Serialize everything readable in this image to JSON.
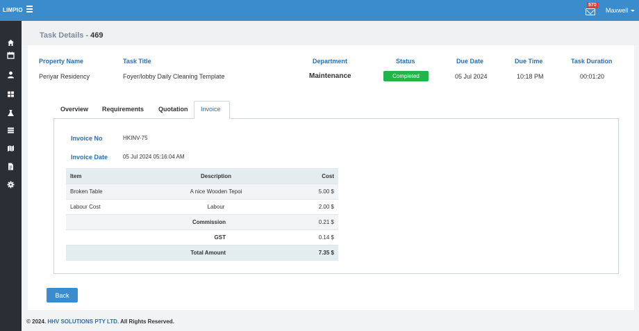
{
  "app": {
    "brand": "LIMPIO"
  },
  "topbar": {
    "notification_count": "570",
    "user_name": "Maxwell"
  },
  "sidebar": {
    "items": [
      {
        "icon": "home-icon"
      },
      {
        "icon": "calendar-icon"
      },
      {
        "icon": "user-icon"
      },
      {
        "icon": "grid-icon"
      },
      {
        "icon": "flask-icon"
      },
      {
        "icon": "list-icon"
      },
      {
        "icon": "map-icon"
      },
      {
        "icon": "file-icon"
      },
      {
        "icon": "settings-icon"
      }
    ]
  },
  "page": {
    "title": "Task Details - ",
    "task_number": "469"
  },
  "summary": {
    "headers": {
      "property": "Property Name",
      "task_title": "Task Title",
      "department": "Department",
      "status": "Status",
      "due_date": "Due Date",
      "due_time": "Due Time",
      "duration": "Task Duration"
    },
    "values": {
      "property": "Periyar Residency",
      "task_title": "Foyer/lobby Daily Cleaning Template",
      "department": "Maintenance",
      "status": "Completed",
      "due_date": "05 Jul 2024",
      "due_time": "10:18 PM",
      "duration": "00:01:20"
    }
  },
  "tabs": [
    "Overview",
    "Requirements",
    "Quotation",
    "Invoice"
  ],
  "invoice": {
    "no_label": "Invoice No",
    "no_value": "HKINV-75",
    "date_label": "Invoice Date",
    "date_value": "05 Jul 2024 05:16:04 AM",
    "columns": {
      "item": "Item",
      "description": "Description",
      "cost": "Cost"
    },
    "rows": [
      {
        "item": "Broken Table",
        "description": "A nice Wooden Tepoi",
        "cost": "5.00 $"
      },
      {
        "item": "Labour Cost",
        "description": "Labour",
        "cost": "2.00 $"
      }
    ],
    "commission_label": "Commission",
    "commission_value": "0.21 $",
    "gst_label": "GST",
    "gst_value": "0.14 $",
    "total_label": "Total Amount",
    "total_value": "7.35 $"
  },
  "actions": {
    "back_label": "Back"
  },
  "footer": {
    "prefix": "© 2024. ",
    "company": "HHV SOLUTIONS PTY LTD.",
    "suffix": " All Rights Reserved."
  }
}
